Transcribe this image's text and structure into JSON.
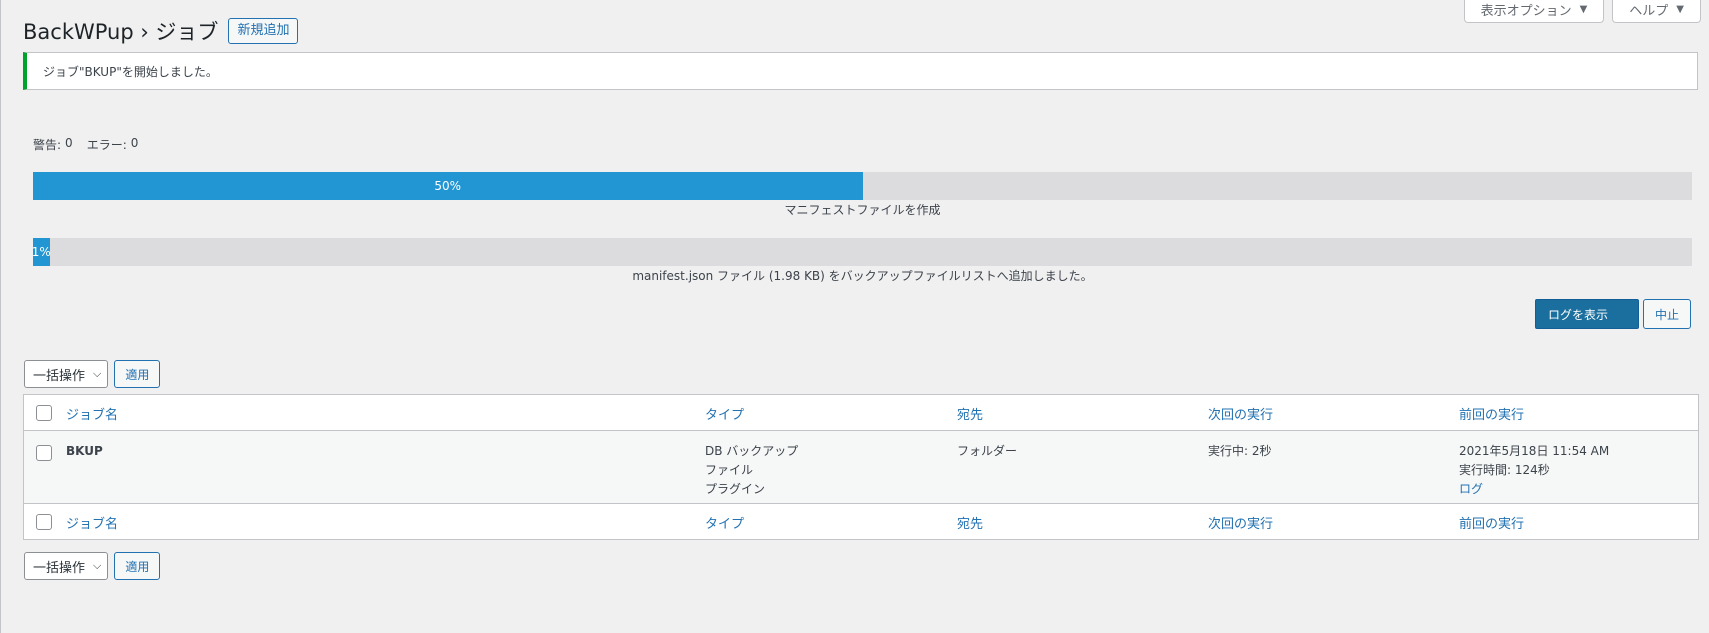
{
  "screen_meta": {
    "options_label": "表示オプション",
    "help_label": "ヘルプ"
  },
  "header": {
    "title": "BackWPup › ジョブ",
    "add_new": "新規追加"
  },
  "notice": {
    "message": "ジョブ\"BKUP\"を開始しました。"
  },
  "stats": {
    "warnings_label": "警告:",
    "warnings": "0",
    "errors_label": "エラー:",
    "errors": "0"
  },
  "progress": {
    "step": {
      "percent_label": "50%",
      "value": 0.5,
      "caption": "マニフェストファイルを作成"
    },
    "sub": {
      "percent_label": "1%",
      "value": 0.01,
      "caption": "manifest.json ファイル (1.98 KB) をバックアップファイルリストへ追加しました。"
    }
  },
  "actions": {
    "show_log": "ログを表示",
    "abort": "中止"
  },
  "bulk": {
    "select_label": "一括操作",
    "apply_label": "適用"
  },
  "table": {
    "columns": [
      "ジョブ名",
      "タイプ",
      "宛先",
      "次回の実行",
      "前回の実行"
    ],
    "rows": [
      {
        "name": "BKUP",
        "type": [
          "DB バックアップ",
          "ファイル",
          "プラグイン"
        ],
        "destination": "フォルダー",
        "next_run": "実行中: 2秒",
        "last_run": [
          "2021年5月18日 11:54 AM",
          "実行時間: 124秒",
          "ログ"
        ]
      }
    ]
  },
  "colors": {
    "accent": "#2271b1",
    "progress": "#2196d3",
    "notice_success": "#00a32a",
    "primary_button": "#1a6f9e"
  }
}
